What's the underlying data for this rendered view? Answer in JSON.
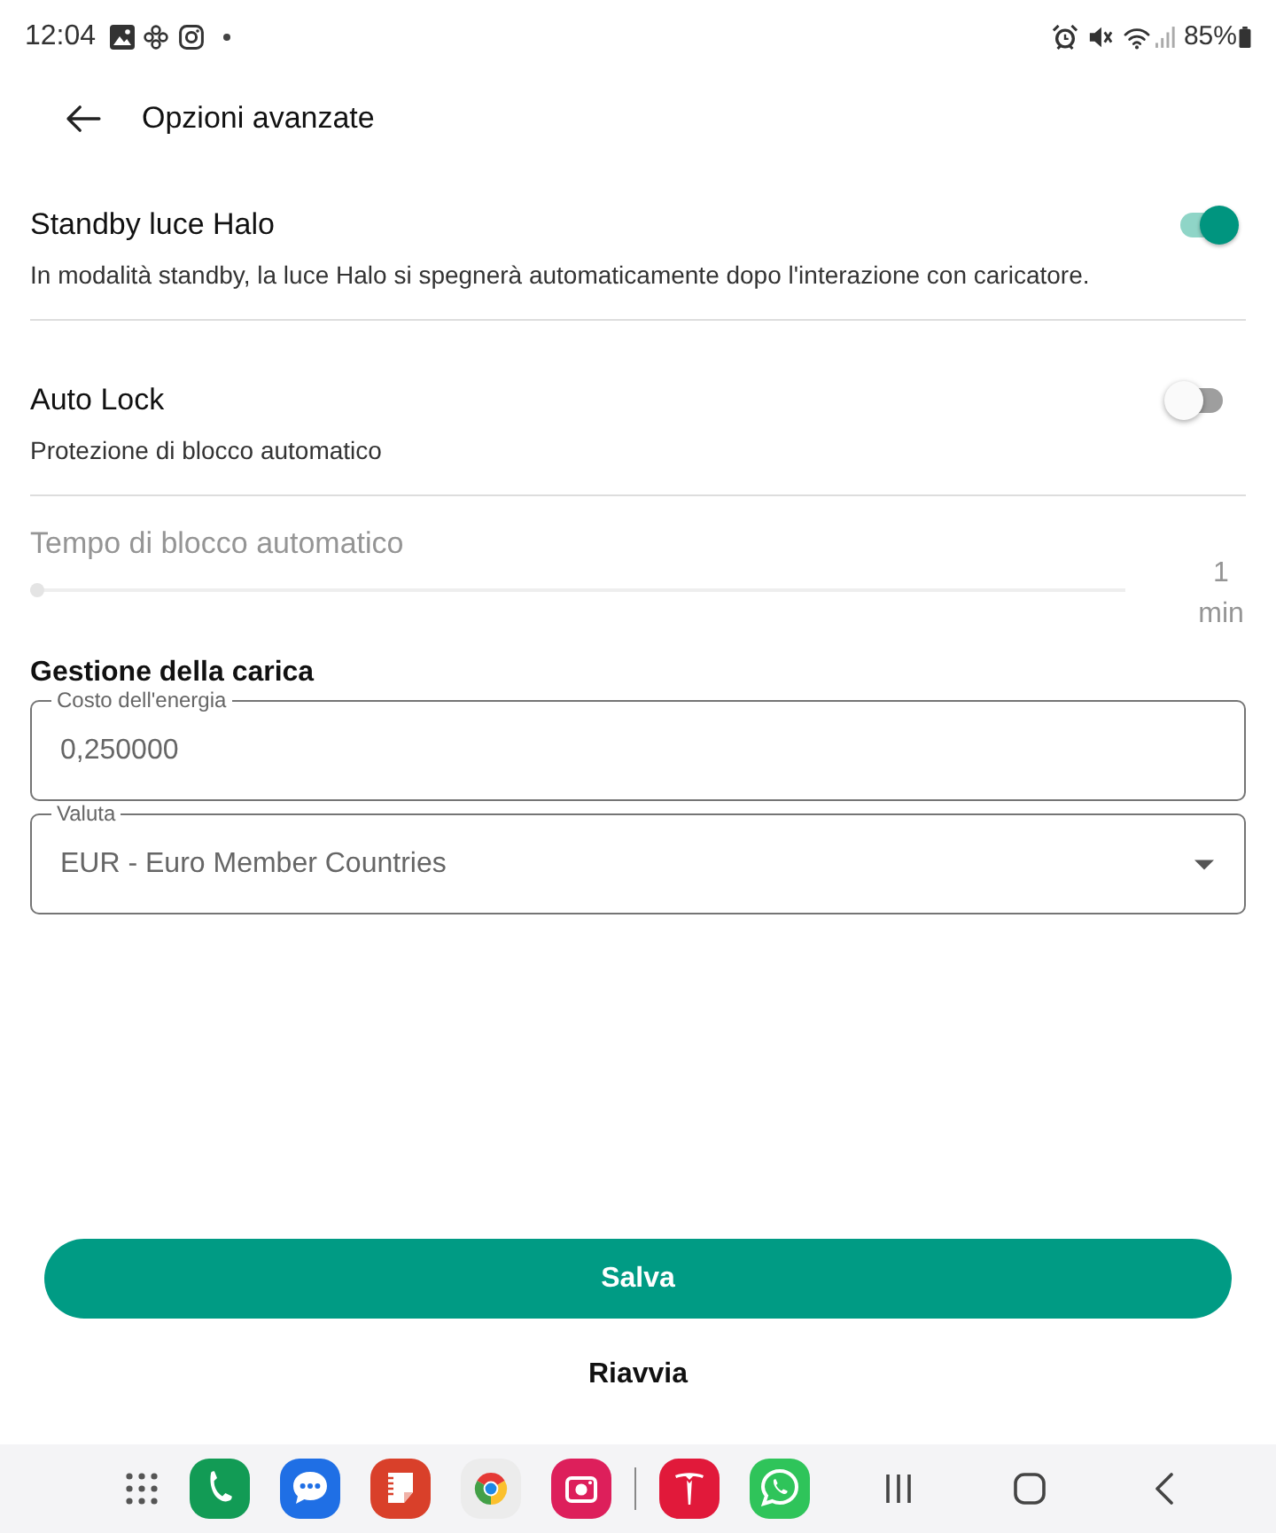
{
  "status_bar": {
    "time": "12:04",
    "battery": "85%"
  },
  "app_bar": {
    "title": "Opzioni avanzate"
  },
  "settings": [
    {
      "kind": "toggle",
      "title": "Standby luce Halo",
      "description": "In modalità standby, la luce Halo si spegnerà automaticamente dopo l'interazione con caricatore.",
      "on": true
    },
    {
      "kind": "toggle",
      "title": "Auto Lock",
      "description": "Protezione di blocco automatico",
      "on": false
    },
    {
      "kind": "slider",
      "title": "Tempo di blocco automatico",
      "disabled": true,
      "level": 0,
      "reading": "1 min"
    }
  ],
  "charging": {
    "title": "Gestione della carica",
    "fields": [
      {
        "kind": "text",
        "label": "Costo dell'energia",
        "value": "0,250000"
      },
      {
        "kind": "select",
        "label": "Valuta",
        "value": "EUR - Euro Member Countries"
      }
    ]
  },
  "actions": [
    {
      "kind": "primary",
      "label": "Salva"
    },
    {
      "kind": "text",
      "label": "Riavvia"
    }
  ]
}
